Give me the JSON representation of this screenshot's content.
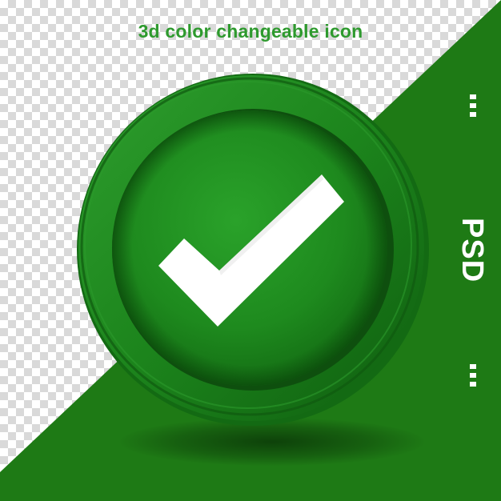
{
  "headline": "3d color changeable icon",
  "badge": "PSD",
  "icon": {
    "name": "check-circle-icon",
    "color": "#1f8a1f",
    "mark_color": "#ffffff"
  },
  "background": {
    "band_color": "#1f7d16",
    "checker_light": "#ffffff",
    "checker_dark": "#d9d9d9"
  }
}
